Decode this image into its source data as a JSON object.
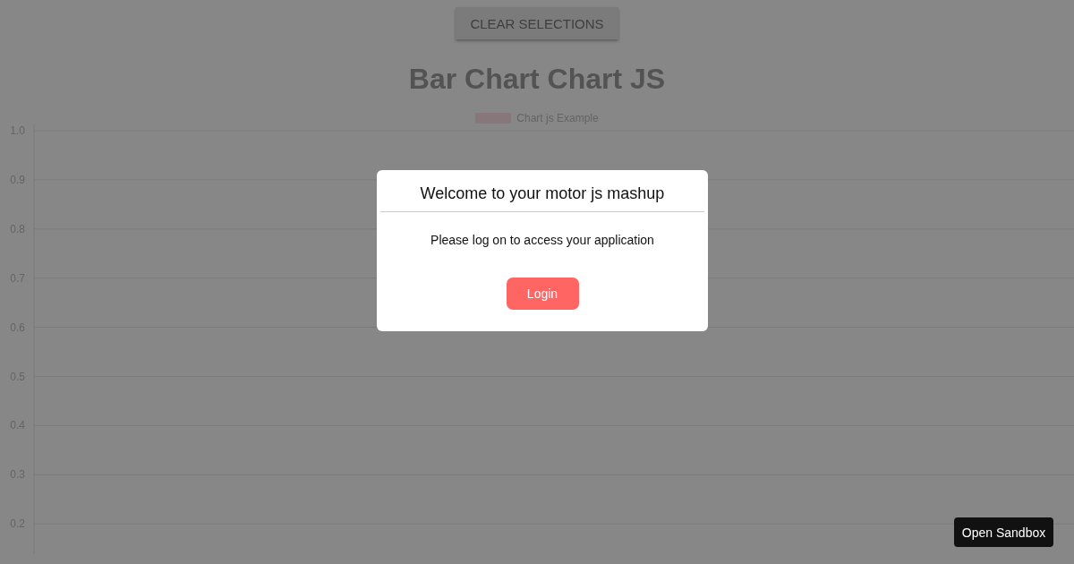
{
  "toolbar": {
    "clear_button": "CLEAR SELECTIONS"
  },
  "title": "Bar Chart Chart JS",
  "chart": {
    "chart_data": {
      "type": "bar",
      "ylim": [
        0,
        1
      ],
      "grid": true,
      "series": [
        {
          "name": "Chart js Example",
          "color": "#ffe0e6"
        }
      ],
      "yticks": [
        {
          "value": 1.0,
          "label": "1.0"
        },
        {
          "value": 0.9,
          "label": "0.9"
        },
        {
          "value": 0.8,
          "label": "0.8"
        },
        {
          "value": 0.7,
          "label": "0.7"
        },
        {
          "value": 0.6,
          "label": "0.6"
        },
        {
          "value": 0.5,
          "label": "0.5"
        },
        {
          "value": 0.4,
          "label": "0.4"
        },
        {
          "value": 0.3,
          "label": "0.3"
        },
        {
          "value": 0.2,
          "label": "0.2"
        }
      ]
    }
  },
  "login_dialog": {
    "title": "Welcome to your motor js mashup",
    "message": "Please log on to access your application",
    "button": "Login"
  },
  "sandbox_button": "Open Sandbox"
}
